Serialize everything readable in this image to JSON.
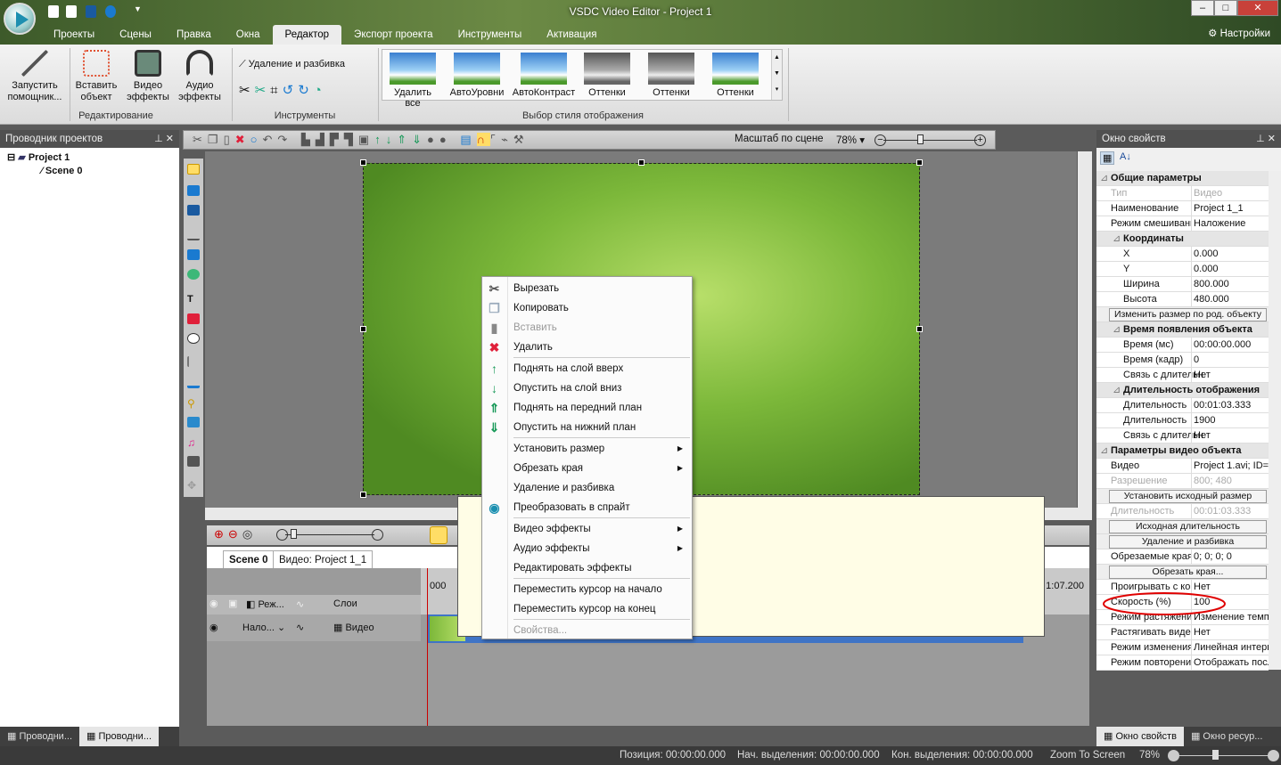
{
  "app": {
    "title": "VSDC Video Editor - Project 1",
    "settings": "Настройки"
  },
  "menu_tabs": [
    "Проекты",
    "Сцены",
    "Правка",
    "Окна",
    "Редактор",
    "Экспорт проекта",
    "Инструменты",
    "Активация"
  ],
  "ribbon": {
    "edit_group": {
      "label": "Редактирование",
      "buttons": [
        {
          "label": "Запустить помощник..."
        },
        {
          "label": "Вставить объект"
        },
        {
          "label": "Видео эффекты"
        },
        {
          "label": "Аудио эффекты"
        }
      ]
    },
    "tools_group": {
      "label": "Инструменты",
      "cut_split": "Удаление и разбивка"
    },
    "style_group": {
      "label": "Выбор стиля отображения",
      "thumbs": [
        "Удалить все",
        "АвтоУровни",
        "АвтоКонтраст",
        "Оттенки",
        "Оттенки",
        "Оттенки"
      ]
    }
  },
  "left_panel": {
    "title": "Проводник проектов",
    "tree": [
      {
        "label": "Project 1"
      },
      {
        "label": "Scene 0"
      }
    ],
    "bottom_tabs": [
      "Проводни...",
      "Проводни..."
    ]
  },
  "toolbar": {
    "zoom_label": "Масштаб по сцене",
    "zoom_value": "78%"
  },
  "timeline": {
    "tabs": [
      "Scene 0",
      "Видео: Project 1_1"
    ],
    "header": {
      "mode": "Реж...",
      "layers": "Слои"
    },
    "row": {
      "blend": "Нало...",
      "name": "Видео"
    },
    "ruler": {
      "start": "000",
      "end": "1:07.200"
    }
  },
  "context_menu": [
    {
      "label": "Вырезать",
      "icon": "scissors-icon",
      "glyph": "✂",
      "color": "#555"
    },
    {
      "label": "Копировать",
      "icon": "copy-icon",
      "glyph": "❐",
      "color": "#9ab"
    },
    {
      "label": "Вставить",
      "icon": "paste-icon",
      "glyph": "▮",
      "color": "#888",
      "disabled": true
    },
    {
      "label": "Удалить",
      "icon": "delete-icon",
      "glyph": "✖",
      "color": "#e0203a",
      "sep_after": true
    },
    {
      "label": "Поднять на слой вверх",
      "icon": "arrow-up-icon",
      "glyph": "↑",
      "color": "#1a9a5a"
    },
    {
      "label": "Опустить на слой вниз",
      "icon": "arrow-down-icon",
      "glyph": "↓",
      "color": "#1a9a5a"
    },
    {
      "label": "Поднять на передний план",
      "icon": "bring-front-icon",
      "glyph": "⇑",
      "color": "#1a9a5a"
    },
    {
      "label": "Опустить на нижний план",
      "icon": "send-back-icon",
      "glyph": "⇓",
      "color": "#1a9a5a",
      "sep_after": true
    },
    {
      "label": "Установить размер",
      "submenu": true
    },
    {
      "label": "Обрезать края",
      "submenu": true
    },
    {
      "label": "Удаление и разбивка"
    },
    {
      "label": "Преобразовать в спрайт",
      "icon": "sprite-icon",
      "glyph": "◉",
      "color": "#1a8fb0",
      "sep_after": true
    },
    {
      "label": "Видео эффекты",
      "submenu": true
    },
    {
      "label": "Аудио эффекты",
      "submenu": true
    },
    {
      "label": "Редактировать эффекты",
      "sep_after": true
    },
    {
      "label": "Переместить курсор на начало"
    },
    {
      "label": "Переместить курсор на конец",
      "sep_after": true
    },
    {
      "label": "Свойства...",
      "disabled": true
    }
  ],
  "properties": {
    "title": "Окно свойств",
    "rows": [
      {
        "t": "cat",
        "k": "Общие параметры"
      },
      {
        "t": "dis",
        "k": "Тип",
        "v": "Видео"
      },
      {
        "k": "Наименование",
        "v": "Project 1_1"
      },
      {
        "k": "Режим смешивания",
        "v": "Наложение"
      },
      {
        "t": "cat sub",
        "k": "Координаты"
      },
      {
        "t": "sub",
        "k": "X",
        "v": "0.000"
      },
      {
        "t": "sub",
        "k": "Y",
        "v": "0.000"
      },
      {
        "t": "sub",
        "k": "Ширина",
        "v": "800.000"
      },
      {
        "t": "sub",
        "k": "Высота",
        "v": "480.000"
      },
      {
        "t": "btn",
        "k": "Изменить размер по род. объекту"
      },
      {
        "t": "cat sub",
        "k": "Время появления объекта"
      },
      {
        "t": "sub",
        "k": "Время (мс)",
        "v": "00:00:00.000"
      },
      {
        "t": "sub",
        "k": "Время (кадр)",
        "v": "0"
      },
      {
        "t": "sub",
        "k": "Связь с длительностью",
        "v": "Нет"
      },
      {
        "t": "cat sub",
        "k": "Длительность отображения"
      },
      {
        "t": "sub",
        "k": "Длительность",
        "v": "00:01:03.333"
      },
      {
        "t": "sub",
        "k": "Длительность",
        "v": "1900"
      },
      {
        "t": "sub",
        "k": "Связь с длительностью",
        "v": "Нет"
      },
      {
        "t": "cat",
        "k": "Параметры видео объекта"
      },
      {
        "k": "Видео",
        "v": "Project 1.avi; ID="
      },
      {
        "t": "dis",
        "k": "Разрешение",
        "v": "800; 480"
      },
      {
        "t": "btn",
        "k": "Установить исходный размер"
      },
      {
        "t": "dis",
        "k": "Длительность",
        "v": "00:01:03.333"
      },
      {
        "t": "btn",
        "k": "Исходная длительность"
      },
      {
        "t": "btn",
        "k": "Удаление и разбивка"
      },
      {
        "k": "Обрезаемые края",
        "v": "0; 0; 0; 0"
      },
      {
        "t": "btn",
        "k": "Обрезать края..."
      },
      {
        "k": "Проигрывать с конца",
        "v": "Нет"
      },
      {
        "t": "hl",
        "k": "Скорость (%)",
        "v": "100"
      },
      {
        "k": "Режим растяжения",
        "v": "Изменение темпа"
      },
      {
        "k": "Растягивать видео",
        "v": "Нет"
      },
      {
        "k": "Режим изменения",
        "v": "Линейная интерполяция"
      },
      {
        "k": "Режим повторения",
        "v": "Отображать последний"
      }
    ],
    "bottom_tabs": [
      "Окно свойств",
      "Окно ресур..."
    ]
  },
  "status": {
    "position_label": "Позиция:",
    "position": "00:00:00.000",
    "sel_start_label": "Нач. выделения:",
    "sel_start": "00:00:00.000",
    "sel_end_label": "Кон. выделения:",
    "sel_end": "00:00:00.000",
    "zoom_to_screen": "Zoom To Screen",
    "zoom": "78%"
  },
  "colors": {
    "highlight_circle": "#e00000",
    "timeline_clip": "#3f74c6",
    "tooltip_bg": "#fffde6"
  }
}
